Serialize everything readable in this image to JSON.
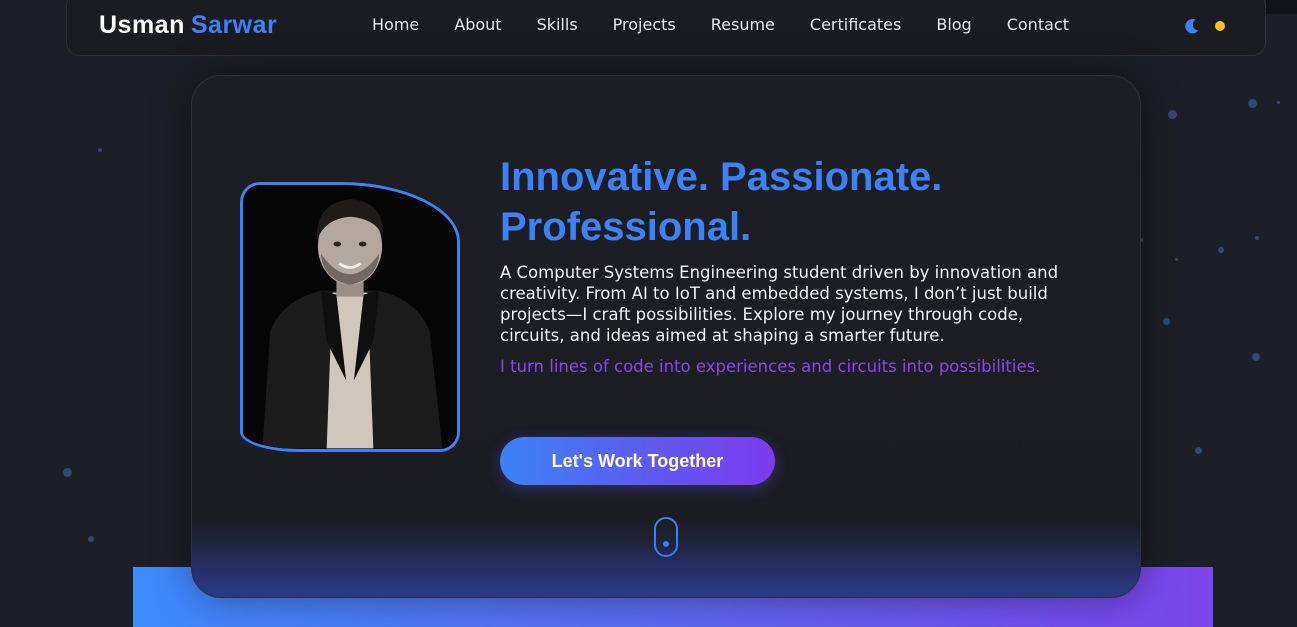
{
  "brand": {
    "first": "Usman",
    "last": "Sarwar"
  },
  "nav": {
    "links": [
      "Home",
      "About",
      "Skills",
      "Projects",
      "Resume",
      "Certificates",
      "Blog",
      "Contact"
    ],
    "theme_icons": [
      "moon-icon",
      "sun-icon"
    ]
  },
  "hero": {
    "headline_line1": "Innovative. Passionate.",
    "headline_line2": "Professional.",
    "description": "A Computer Systems Engineering student driven by innovation and creativity. From AI to IoT and embedded systems, I don’t just build projects—I craft possibilities. Explore my journey through code, circuits, and ideas aimed at shaping a smarter future.",
    "tagline": "I turn lines of code into experiences and circuits into possibilities.",
    "cta_label": "Let's Work Together"
  },
  "colors": {
    "accent_blue": "#3b82f6",
    "accent_purple": "#7c3aed",
    "background": "#1c1f25",
    "sun": "#fbbf24"
  }
}
